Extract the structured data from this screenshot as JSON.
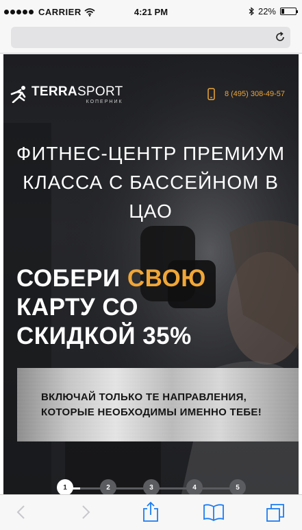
{
  "status_bar": {
    "carrier": "CARRIER",
    "time": "4:21 PM",
    "battery_label": "22%",
    "battery_level": 0.22
  },
  "browser": {
    "url_text": ""
  },
  "site": {
    "logo_main": "TERRA",
    "logo_second": "SPORT",
    "logo_sub": "КОПЕРНИК",
    "phone": "8 (495) 308-49-57"
  },
  "hero": {
    "headline": "ФИТНЕС-ЦЕНТР ПРЕМИУМ КЛАССА С БАССЕЙНОМ В ЦАО",
    "promo_part1": "СОБЕРИ ",
    "promo_accent": "СВОЮ",
    "promo_part2": "КАРТУ СО СКИДКОЙ 35%",
    "plate_text": "ВКЛЮЧАЙ ТОЛЬКО ТЕ НАПРАВЛЕНИЯ, КОТОРЫЕ НЕОБХОДИМЫ ИМЕННО ТЕБЕ!"
  },
  "steps": {
    "items": [
      "1",
      "2",
      "3",
      "4",
      "5"
    ],
    "active": 1
  },
  "colors": {
    "accent": "#f0a637",
    "hero_bg": "#1e1f22"
  },
  "icons": {
    "wifi": "wifi-icon",
    "bluetooth": "bluetooth-icon",
    "reload": "reload-icon",
    "phone": "mobile-phone-icon",
    "back": "chevron-left-icon",
    "forward": "chevron-right-icon",
    "share": "share-icon",
    "bookmarks": "book-icon",
    "tabs": "tabs-icon"
  }
}
